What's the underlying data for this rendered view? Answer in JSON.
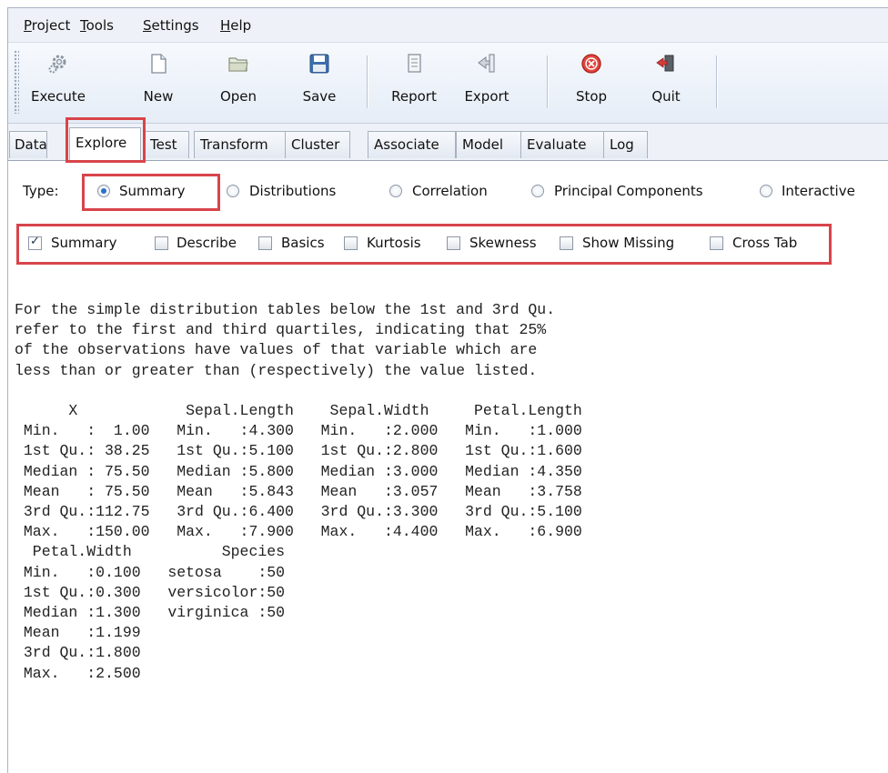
{
  "menu": [
    "Project",
    "Tools",
    "Settings",
    "Help"
  ],
  "menu_underline": [
    "P",
    "T",
    "S",
    "H"
  ],
  "toolbar": {
    "execute": "Execute",
    "new": "New",
    "open": "Open",
    "save": "Save",
    "report": "Report",
    "export": "Export",
    "stop": "Stop",
    "quit": "Quit"
  },
  "tabs": [
    "Data",
    "Explore",
    "Test",
    "Transform",
    "Cluster",
    "Associate",
    "Model",
    "Evaluate",
    "Log"
  ],
  "active_tab": "Explore",
  "type_row": {
    "label": "Type:",
    "options": [
      "Summary",
      "Distributions",
      "Correlation",
      "Principal Components",
      "Interactive"
    ],
    "selected": "Summary"
  },
  "checkbox_row": {
    "items": [
      "Summary",
      "Describe",
      "Basics",
      "Kurtosis",
      "Skewness",
      "Show Missing",
      "Cross Tab"
    ],
    "checked": [
      "Summary"
    ]
  },
  "output_text": "For the simple distribution tables below the 1st and 3rd Qu.\nrefer to the first and third quartiles, indicating that 25%\nof the observations have values of that variable which are\nless than or greater than (respectively) the value listed.\n\n      X            Sepal.Length    Sepal.Width     Petal.Length\n Min.   :  1.00   Min.   :4.300   Min.   :2.000   Min.   :1.000\n 1st Qu.: 38.25   1st Qu.:5.100   1st Qu.:2.800   1st Qu.:1.600\n Median : 75.50   Median :5.800   Median :3.000   Median :4.350\n Mean   : 75.50   Mean   :5.843   Mean   :3.057   Mean   :3.758\n 3rd Qu.:112.75   3rd Qu.:6.400   3rd Qu.:3.300   3rd Qu.:5.100\n Max.   :150.00   Max.   :7.900   Max.   :4.400   Max.   :6.900\n  Petal.Width          Species\n Min.   :0.100   setosa    :50\n 1st Qu.:0.300   versicolor:50\n Median :1.300   virginica :50\n Mean   :1.199\n 3rd Qu.:1.800\n Max.   :2.500",
  "colors": {
    "highlight": "#d8444a",
    "stop_icon": "#e0463f",
    "radio_selected": "#2c6fc8"
  },
  "icons": {
    "execute": "gear-icon",
    "new": "new-document-icon",
    "open": "folder-open-icon",
    "save": "floppy-disk-icon",
    "report": "report-icon",
    "export": "export-icon",
    "stop": "stop-icon",
    "quit": "quit-door-icon"
  }
}
